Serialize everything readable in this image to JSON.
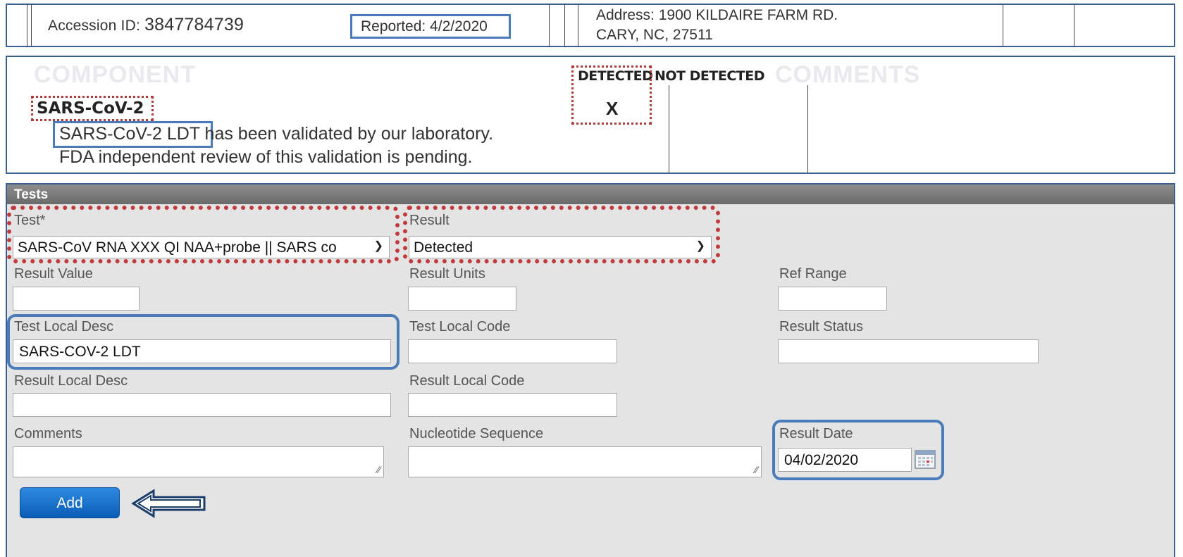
{
  "report_header": {
    "accession_label": "Accession ID: ",
    "accession_id": "3847784739",
    "reported": "Reported: 4/2/2020",
    "address_line1": "Address: 1900 KILDAIRE FARM RD.",
    "address_line2": "CARY, NC, 27511"
  },
  "result_block": {
    "col_detected": "DETECTED",
    "col_not_detected": "NOT DETECTED",
    "faint_left": "COMPONENT",
    "faint_right": "COMMENTS",
    "test_name": "SARS-CoV-2",
    "detected_mark": "X",
    "desc_highlight": "SARS-CoV-2 LDT",
    "desc_rest": " has been validated by our laboratory.",
    "desc_line2": "FDA independent review of this validation is pending."
  },
  "tests": {
    "title": "Tests",
    "test_label": "Test*",
    "test_value": "SARS-CoV RNA XXX QI NAA+probe || SARS co",
    "result_label": "Result",
    "result_value": "Detected",
    "result_value_label": "Result Value",
    "result_units_label": "Result Units",
    "ref_range_label": "Ref Range",
    "test_local_desc_label": "Test Local Desc",
    "test_local_desc_value": "SARS-COV-2 LDT",
    "test_local_code_label": "Test Local Code",
    "result_status_label": "Result Status",
    "result_local_desc_label": "Result Local Desc",
    "result_local_code_label": "Result Local Code",
    "comments_label": "Comments",
    "nucleotide_label": "Nucleotide Sequence",
    "result_date_label": "Result Date",
    "result_date_value": "04/02/2020",
    "add_label": "Add"
  },
  "colors": {
    "highlight_blue": "#4a7cba",
    "highlight_red": "#c0393b",
    "panel_bg": "#e4e4e4",
    "button_blue": "#0a5cb5"
  },
  "icons": {
    "calendar": "calendar-icon",
    "pointer": "arrow-left-icon",
    "select": "chevron-down-icon"
  }
}
